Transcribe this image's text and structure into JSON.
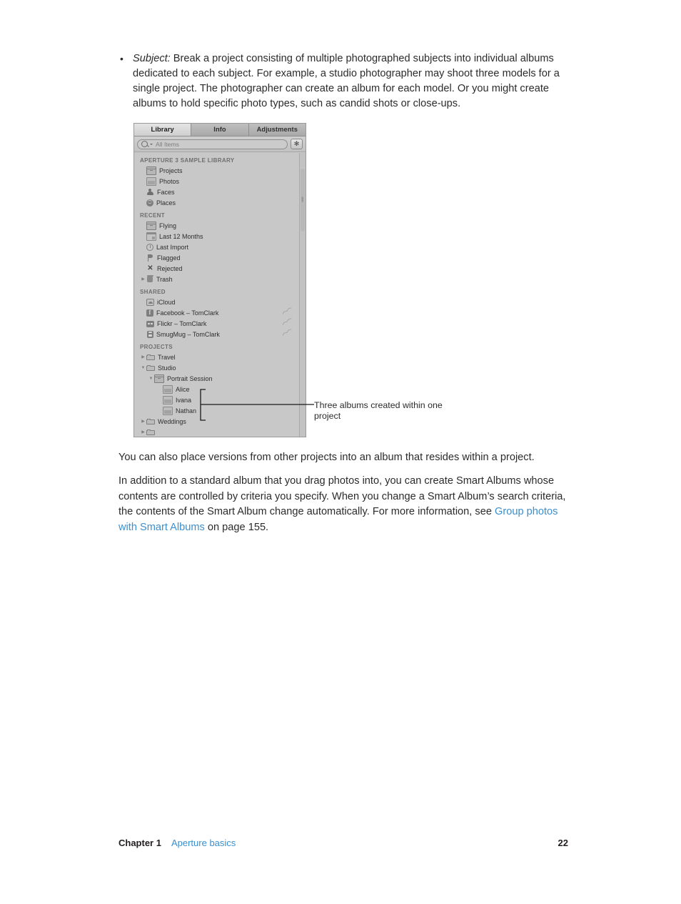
{
  "document": {
    "bullet": {
      "marker": "•",
      "term": "Subject:",
      "text": " Break a project consisting of multiple photographed subjects into individual albums dedicated to each subject. For example, a studio photographer may shoot three models for a single project. The photographer can create an album for each model. Or you might create albums to hold specific photo types, such as candid shots or close-ups."
    },
    "paragraph_1": "You can also place versions from other projects into an album that resides within a project.",
    "paragraph_2": {
      "before_link": "In addition to a standard album that you drag photos into, you can create Smart Albums whose contents are controlled by criteria you specify. When you change a Smart Album’s search criteria, the contents of the Smart Album change automatically. For more information, see ",
      "link": "Group photos with Smart Albums",
      "after_link": " on page 155."
    },
    "callout": "Three albums created within one project",
    "footer": {
      "chapter": "Chapter 1",
      "chapter_title": "Aperture basics",
      "page_number": "22"
    }
  },
  "screenshot": {
    "tabs": [
      {
        "label": "Library",
        "active": true
      },
      {
        "label": "Info",
        "active": false
      },
      {
        "label": "Adjustments",
        "active": false
      }
    ],
    "search": {
      "placeholder": "All Items",
      "icon": "search-icon",
      "caret_icon": "chevron-down-icon"
    },
    "action_button": {
      "icon": "gear-icon",
      "glyph": "✻"
    },
    "groups": [
      {
        "header": "APERTURE 3 SAMPLE LIBRARY",
        "items": [
          {
            "label": "Projects",
            "icon": "projects-icon",
            "indent": 1,
            "disclosure": "none"
          },
          {
            "label": "Photos",
            "icon": "photos-icon",
            "indent": 1,
            "disclosure": "none"
          },
          {
            "label": "Faces",
            "icon": "faces-icon",
            "indent": 1,
            "disclosure": "none"
          },
          {
            "label": "Places",
            "icon": "places-icon",
            "indent": 1,
            "disclosure": "none"
          }
        ]
      },
      {
        "header": "RECENT",
        "items": [
          {
            "label": "Flying",
            "icon": "project-icon",
            "indent": 1,
            "disclosure": "none"
          },
          {
            "label": "Last 12 Months",
            "icon": "calendar-icon",
            "indent": 1,
            "disclosure": "none"
          },
          {
            "label": "Last Import",
            "icon": "clock-icon",
            "indent": 1,
            "disclosure": "none"
          },
          {
            "label": "Flagged",
            "icon": "flag-icon",
            "indent": 1,
            "disclosure": "none"
          },
          {
            "label": "Rejected",
            "icon": "reject-x-icon",
            "indent": 1,
            "disclosure": "none"
          },
          {
            "label": "Trash",
            "icon": "trash-icon",
            "indent": 1,
            "disclosure": "collapsed"
          }
        ]
      },
      {
        "header": "SHARED",
        "items": [
          {
            "label": "iCloud",
            "icon": "icloud-icon",
            "indent": 1,
            "disclosure": "none"
          },
          {
            "label": "Facebook – TomClark",
            "icon": "facebook-icon",
            "indent": 1,
            "disclosure": "none",
            "badge": "share-wifi-icon"
          },
          {
            "label": "Flickr – TomClark",
            "icon": "flickr-icon",
            "indent": 1,
            "disclosure": "none",
            "badge": "share-wifi-icon"
          },
          {
            "label": "SmugMug – TomClark",
            "icon": "smugmug-icon",
            "indent": 1,
            "disclosure": "none",
            "badge": "share-wifi-icon"
          }
        ]
      },
      {
        "header": "PROJECTS",
        "items": [
          {
            "label": "Travel",
            "icon": "folder-icon",
            "indent": 1,
            "disclosure": "collapsed"
          },
          {
            "label": "Studio",
            "icon": "folder-icon",
            "indent": 1,
            "disclosure": "expanded"
          },
          {
            "label": "Portrait Session",
            "icon": "project-icon",
            "indent": 2,
            "disclosure": "expanded"
          },
          {
            "label": "Alice",
            "icon": "album-icon",
            "indent": 3,
            "disclosure": "none"
          },
          {
            "label": "Ivana",
            "icon": "album-icon",
            "indent": 3,
            "disclosure": "none"
          },
          {
            "label": "Nathan",
            "icon": "album-icon",
            "indent": 3,
            "disclosure": "none"
          },
          {
            "label": "Weddings",
            "icon": "folder-icon",
            "indent": 1,
            "disclosure": "collapsed"
          }
        ]
      }
    ]
  },
  "colors": {
    "link": "#3a8fd0",
    "body_text": "#2b2b2b",
    "panel_bg": "#c8c8c8",
    "group_header": "#6e6e6e"
  }
}
